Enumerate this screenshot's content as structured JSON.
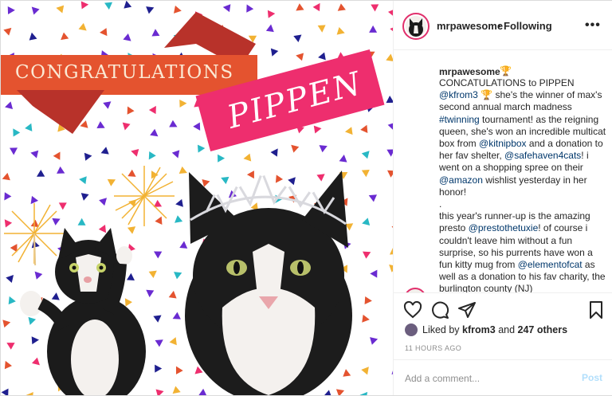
{
  "colors": {
    "banner_left": "#e4532f",
    "banner_right": "#ee2e6e",
    "link": "#00376b",
    "post_disabled": "#b2dffc",
    "story_ring": "#e1306c"
  },
  "image": {
    "banner_left_text": "CONGRATULATIONS",
    "banner_right_text": "PIPPEN",
    "confetti_colors": [
      "#6a2bd1",
      "#f2b233",
      "#ee2e6e",
      "#28b8c4",
      "#e4532f",
      "#1f1f8f"
    ]
  },
  "header": {
    "username": "mrpawesome",
    "separator": "•",
    "follow_status": "Following",
    "more_icon": "more-horizontal-icon",
    "more_glyph": "•••"
  },
  "caption": {
    "username": "mrpawesome",
    "trophy": "🏆",
    "segments": [
      {
        "t": "CONCATULATIONS to PIPPEN "
      },
      {
        "t": "@kfrom3",
        "link": true
      },
      {
        "t": " 🏆 she's the winner of max's second annual march madness "
      },
      {
        "t": "#twinning",
        "link": true
      },
      {
        "t": " tournament! as the reigning queen, she's won an incredible multicat box from "
      },
      {
        "t": "@kitnipbox",
        "link": true
      },
      {
        "t": " and a donation to her fav shelter, "
      },
      {
        "t": "@safehaven4cats",
        "link": true
      },
      {
        "t": "! i went on a shopping spree on their "
      },
      {
        "t": "@amazon",
        "link": true
      },
      {
        "t": " wishlist yesterday in her honor!\n.\nthis year's runner-up is the amazing presto "
      },
      {
        "t": "@prestothetuxie",
        "link": true
      },
      {
        "t": "! of course i couldn't leave him without a fun surprise, so his purrents have won a fun kitty mug from "
      },
      {
        "t": "@elementofcat",
        "link": true
      },
      {
        "t": " as well as a donation to his fav charity, the burlington county (NJ)"
      }
    ]
  },
  "actions": {
    "like_icon": "heart-icon",
    "comment_icon": "comment-icon",
    "share_icon": "share-icon",
    "save_icon": "bookmark-icon"
  },
  "likes": {
    "prefix": "Liked by ",
    "user": "kfrom3",
    "middle": " and ",
    "others": "247 others"
  },
  "timestamp": "11 HOURS AGO",
  "comment": {
    "placeholder": "Add a comment...",
    "post_label": "Post"
  }
}
